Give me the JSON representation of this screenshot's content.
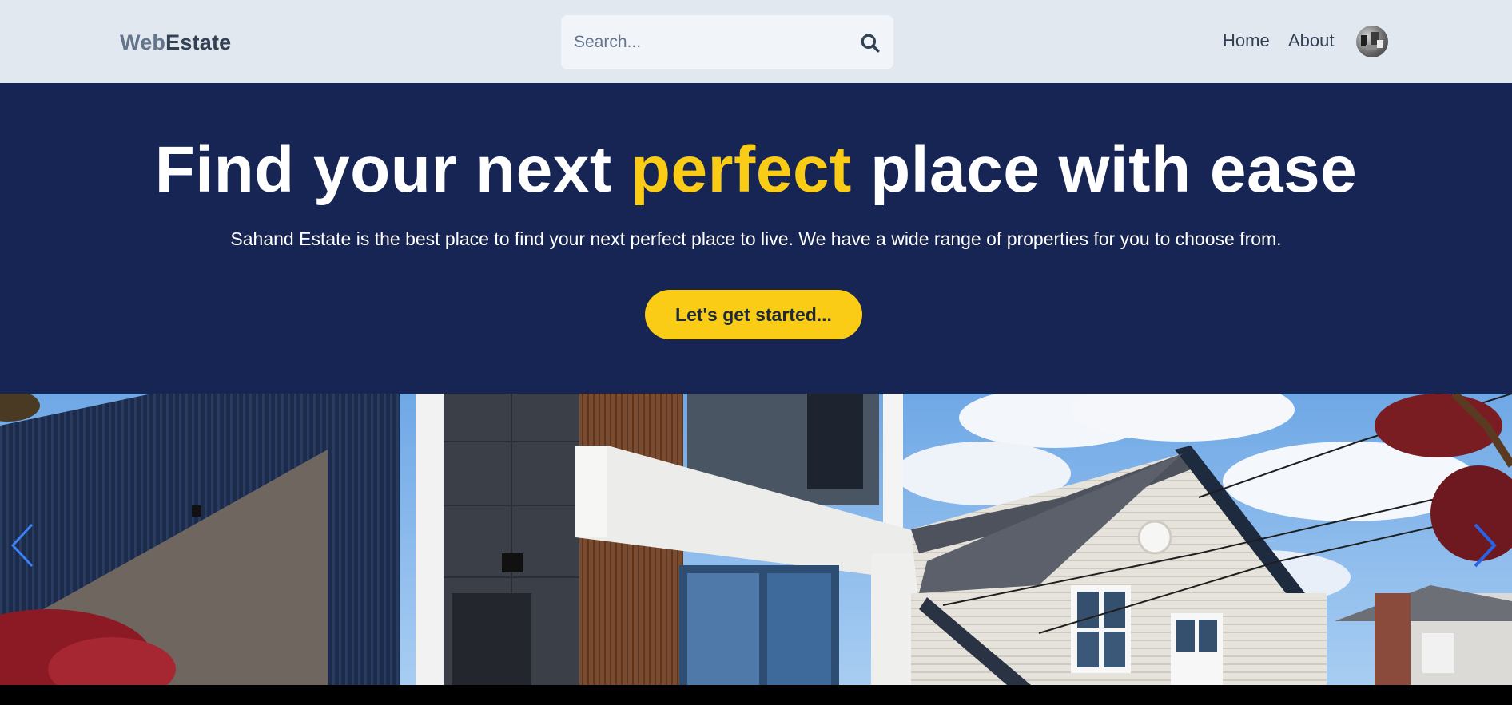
{
  "header": {
    "logo_part1": "Web",
    "logo_part2": "Estate",
    "search_placeholder": "Search...",
    "nav": {
      "home": "Home",
      "about": "About"
    }
  },
  "hero": {
    "title_before": "Find your next ",
    "title_highlight": "perfect",
    "title_after": " place with ease",
    "subtitle": "Sahand Estate is the best place to find your next perfect place to live. We have a wide range of properties for you to choose from.",
    "cta_label": "Let's get started..."
  },
  "colors": {
    "header_bg": "#e2e8f0",
    "hero_bg": "#172554",
    "accent": "#facc15"
  },
  "icons": {
    "search": "search-icon",
    "prev": "chevron-left-icon",
    "next": "chevron-right-icon"
  }
}
